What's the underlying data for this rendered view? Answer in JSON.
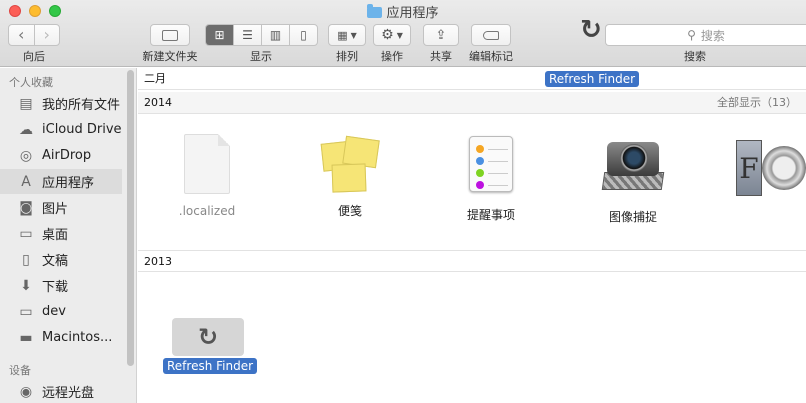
{
  "window": {
    "title": "应用程序"
  },
  "toolbar": {
    "back_label": "向后",
    "new_folder_label": "新建文件夹",
    "view_label": "显示",
    "arrange_label": "排列",
    "action_label": "操作",
    "share_label": "共享",
    "tags_label": "编辑标记",
    "search_label": "搜索",
    "search_placeholder": "搜索"
  },
  "sidebar": {
    "favorites_header": "个人收藏",
    "devices_header": "设备",
    "items": [
      {
        "label": "我的所有文件",
        "icon": "all-files-icon"
      },
      {
        "label": "iCloud Drive",
        "icon": "cloud-icon"
      },
      {
        "label": "AirDrop",
        "icon": "airdrop-icon"
      },
      {
        "label": "应用程序",
        "icon": "applications-icon",
        "selected": true
      },
      {
        "label": "图片",
        "icon": "camera-icon"
      },
      {
        "label": "桌面",
        "icon": "desktop-icon"
      },
      {
        "label": "文稿",
        "icon": "document-icon"
      },
      {
        "label": "下载",
        "icon": "download-icon"
      },
      {
        "label": "dev",
        "icon": "folder-icon"
      },
      {
        "label": "Macintos...",
        "icon": "disk-icon"
      }
    ],
    "device_items": [
      {
        "label": "远程光盘",
        "icon": "optical-disc-icon"
      }
    ]
  },
  "main": {
    "groups": [
      {
        "label": "二月"
      },
      {
        "label": "2014",
        "show_all": "全部显示（13）"
      },
      {
        "label": "2013"
      }
    ],
    "apps": [
      {
        "name": ".localized",
        "icon": "document-icon"
      },
      {
        "name": "便笺",
        "icon": "stickies-icon"
      },
      {
        "name": "提醒事项",
        "icon": "reminders-icon"
      },
      {
        "name": "图像捕捉",
        "icon": "image-capture-icon"
      }
    ],
    "drag_overlay_label": "Refresh Finder",
    "drag_item_label": "Refresh Finder"
  },
  "colors": {
    "selection_blue": "#3d73c6",
    "close": "#fc5f57",
    "minimize": "#fdbc2e",
    "maximize": "#33c748"
  }
}
